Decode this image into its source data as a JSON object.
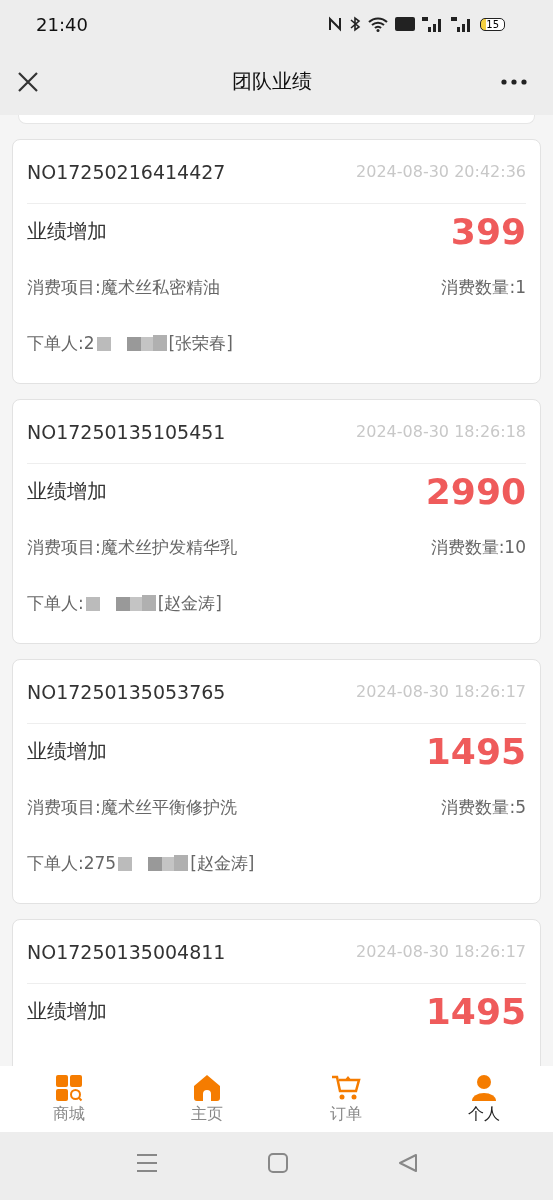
{
  "status_bar": {
    "time": "21:40",
    "battery": "15"
  },
  "header": {
    "title": "团队业绩"
  },
  "records": [
    {
      "order_no": "NO17250216414427",
      "time": "2024-08-30 20:42:36",
      "label": "业绩增加",
      "amount": "399",
      "item": "消费项目:魔术丝私密精油",
      "quantity": "消费数量:1",
      "orderer": "下单人:2",
      "orderer_name": "[张荣春]"
    },
    {
      "order_no": "NO17250135105451",
      "time": "2024-08-30 18:26:18",
      "label": "业绩增加",
      "amount": "2990",
      "item": "消费项目:魔术丝护发精华乳",
      "quantity": "消费数量:10",
      "orderer": "下单人:",
      "orderer_name": "[赵金涛]"
    },
    {
      "order_no": "NO17250135053765",
      "time": "2024-08-30 18:26:17",
      "label": "业绩增加",
      "amount": "1495",
      "item": "消费项目:魔术丝平衡修护洗",
      "quantity": "消费数量:5",
      "orderer": "下单人:275",
      "orderer_name": "[赵金涛]"
    },
    {
      "order_no": "NO17250135004811",
      "time": "2024-08-30 18:26:17",
      "label": "业绩增加",
      "amount": "1495"
    }
  ],
  "tabs": [
    {
      "label": "商城",
      "kind": "shop",
      "selected": false
    },
    {
      "label": "主页",
      "kind": "home",
      "selected": false
    },
    {
      "label": "订单",
      "kind": "cart",
      "selected": false
    },
    {
      "label": "个人",
      "kind": "person",
      "selected": true
    }
  ]
}
